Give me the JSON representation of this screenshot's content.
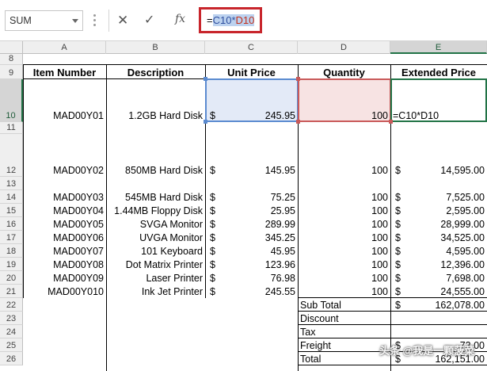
{
  "name_box": {
    "value": "SUM"
  },
  "formula_bar": {
    "fx_label": "fx",
    "formula_prefix": "=",
    "ref1": "C10",
    "operator": "*",
    "ref2": "D10"
  },
  "columns": [
    "A",
    "B",
    "C",
    "D",
    "E"
  ],
  "rows": {
    "r8": "8",
    "r9": "9",
    "r10": "10",
    "r11": "11",
    "r12": "12",
    "r13": "13",
    "r14": "14",
    "r15": "15",
    "r16": "16",
    "r17": "17",
    "r18": "18",
    "r19": "19",
    "r20": "20",
    "r21": "21",
    "r22": "22",
    "r23": "23",
    "r24": "24",
    "r25": "25",
    "r26": "26"
  },
  "headers": {
    "item_number": "Item Number",
    "description": "Description",
    "unit_price": "Unit Price",
    "quantity": "Quantity",
    "extended_price": "Extended Price"
  },
  "currency_symbol": "$",
  "items": [
    {
      "item": "MAD00Y01",
      "desc": "1.2GB Hard Disk",
      "price": "245.95",
      "qty": "100",
      "ext": "=C10*D10"
    },
    {
      "item": "MAD00Y02",
      "desc": "850MB Hard Disk",
      "price": "145.95",
      "qty": "100",
      "ext": "14,595.00"
    },
    {
      "item": "MAD00Y03",
      "desc": "545MB Hard Disk",
      "price": "75.25",
      "qty": "100",
      "ext": "7,525.00"
    },
    {
      "item": "MAD00Y04",
      "desc": "1.44MB Floppy Disk",
      "price": "25.95",
      "qty": "100",
      "ext": "2,595.00"
    },
    {
      "item": "MAD00Y05",
      "desc": "SVGA Monitor",
      "price": "289.99",
      "qty": "100",
      "ext": "28,999.00"
    },
    {
      "item": "MAD00Y06",
      "desc": "UVGA Monitor",
      "price": "345.25",
      "qty": "100",
      "ext": "34,525.00"
    },
    {
      "item": "MAD00Y07",
      "desc": "101 Keyboard",
      "price": "45.95",
      "qty": "100",
      "ext": "4,595.00"
    },
    {
      "item": "MAD00Y08",
      "desc": "Dot Matrix Printer",
      "price": "123.96",
      "qty": "100",
      "ext": "12,396.00"
    },
    {
      "item": "MAD00Y09",
      "desc": "Laser Printer",
      "price": "76.98",
      "qty": "100",
      "ext": "7,698.00"
    },
    {
      "item": "MAD00Y010",
      "desc": "Ink Jet Printer",
      "price": "245.55",
      "qty": "100",
      "ext": "24,555.00"
    }
  ],
  "summary": {
    "subtotal_label": "Sub Total",
    "subtotal_value": "162,078.00",
    "discount_label": "Discount",
    "tax_label": "Tax",
    "freight_label": "Freight",
    "freight_value": "73.00",
    "total_label": "Total",
    "total_value": "162,151.00"
  },
  "watermark": "头条 @我是一颗菠菜"
}
